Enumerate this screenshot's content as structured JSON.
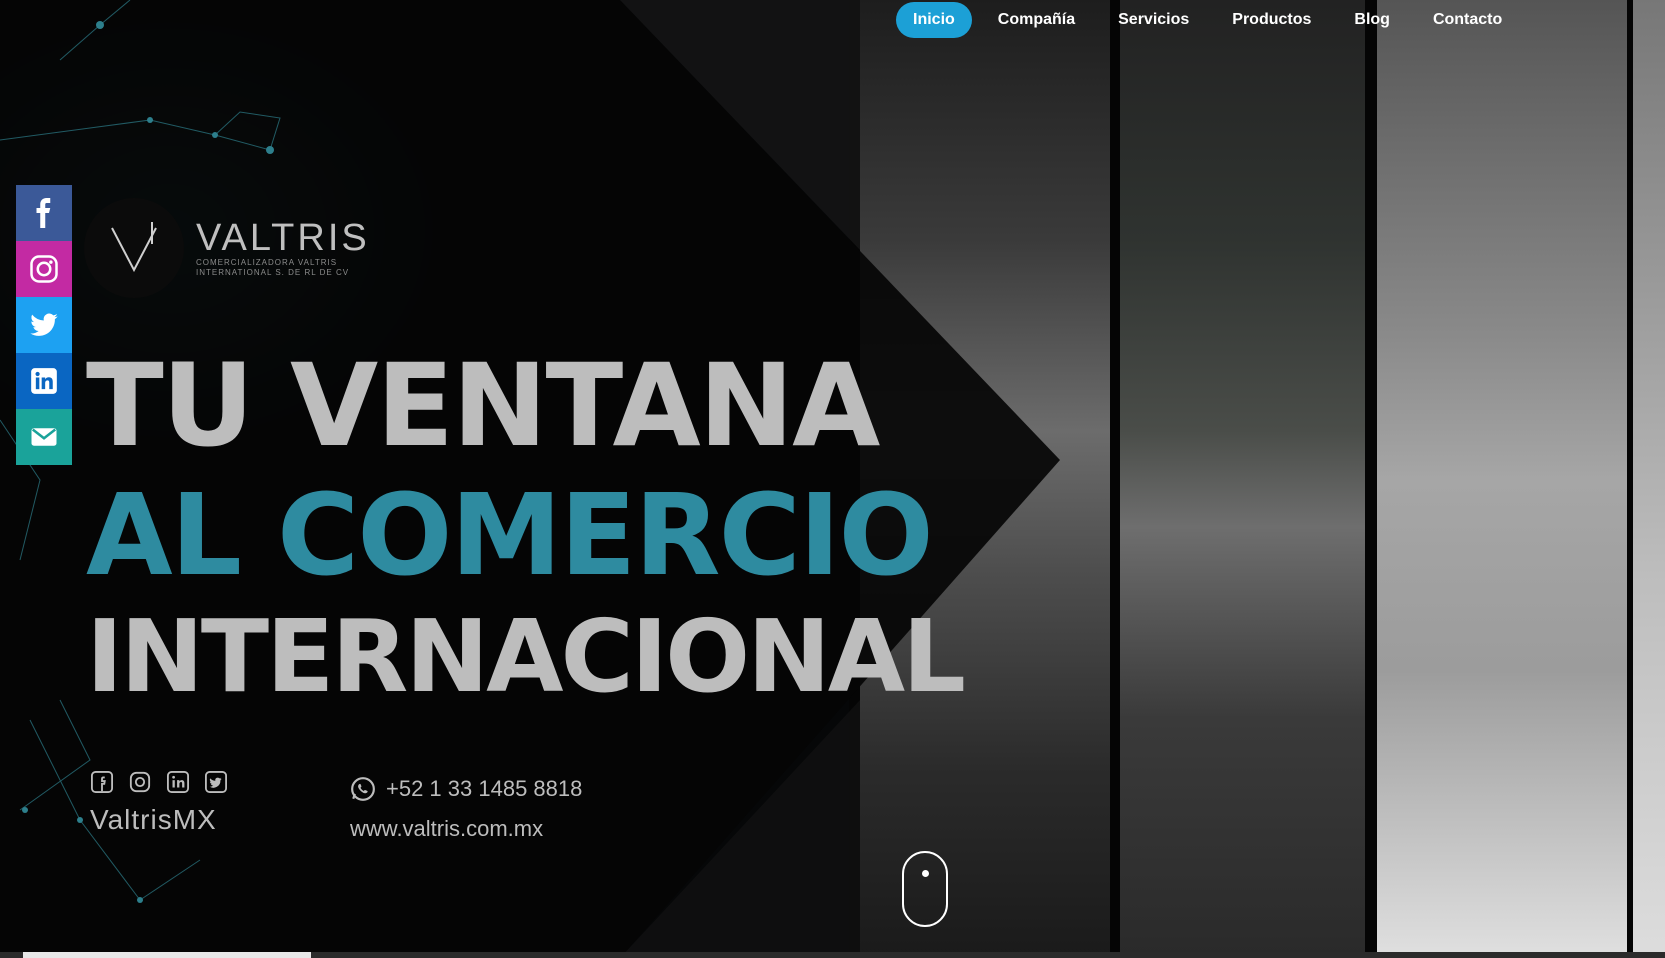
{
  "nav": {
    "items": [
      {
        "label": "Inicio",
        "active": true
      },
      {
        "label": "Compañía"
      },
      {
        "label": "Servicios"
      },
      {
        "label": "Productos"
      },
      {
        "label": "Blog"
      },
      {
        "label": "Contacto"
      }
    ],
    "active_color": "#1ca0d6"
  },
  "social_sidebar": [
    {
      "icon": "facebook-icon",
      "color": "#3b5998"
    },
    {
      "icon": "instagram-icon",
      "color": "#c32aa3"
    },
    {
      "icon": "twitter-icon",
      "color": "#1da1f2"
    },
    {
      "icon": "linkedin-icon",
      "color": "#0a66c2"
    },
    {
      "icon": "email-icon",
      "color": "#1aa39a"
    }
  ],
  "logo": {
    "name": "VALTRIS",
    "subtitle": "COMERCIALIZADORA VALTRIS INTERNATIONAL S. DE RL DE CV"
  },
  "hero": {
    "line1": "TU VENTANA",
    "line2_a": "AL ",
    "line2_b": "COMERCIO",
    "line3": "INTERNACIONAL",
    "accent_color": "#2e8ba0"
  },
  "contact": {
    "handle": "ValtrisMX",
    "phone": "+52 1 33 1485 8818",
    "website": "www.valtris.com.mx",
    "mini_icons": [
      "facebook-icon",
      "instagram-icon",
      "linkedin-icon",
      "twitter-icon"
    ]
  }
}
